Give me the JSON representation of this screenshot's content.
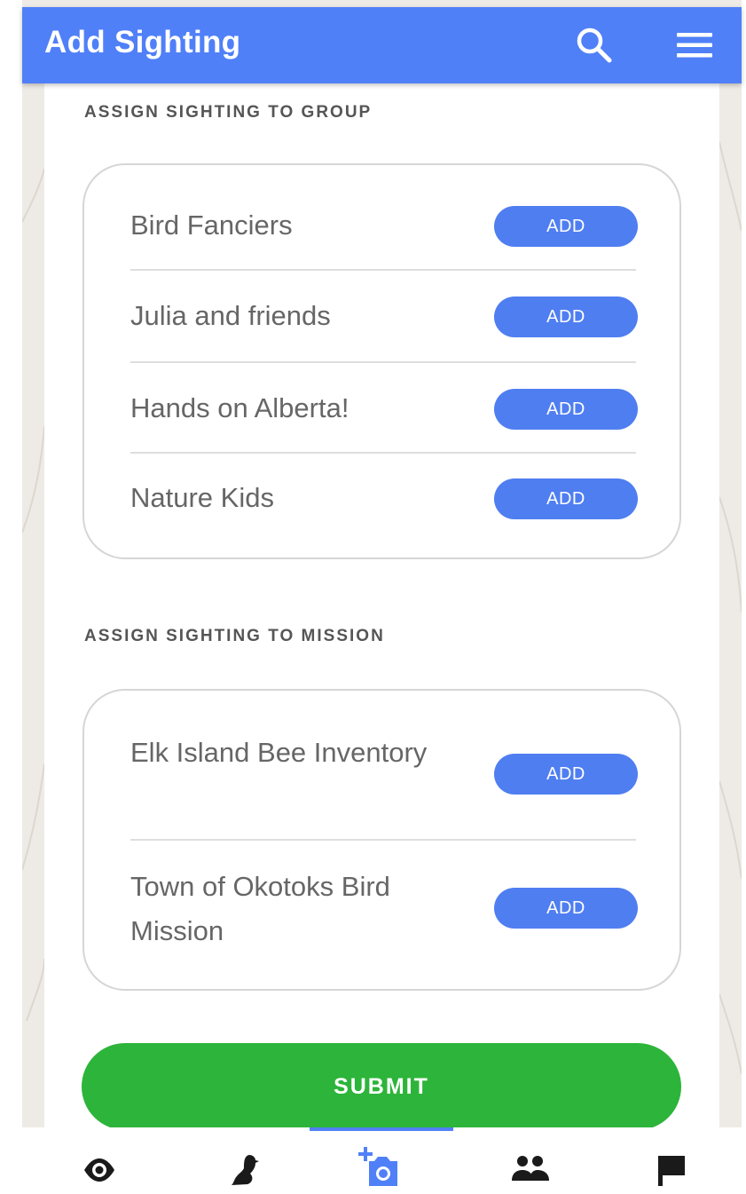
{
  "appbar": {
    "title": "Add Sighting",
    "search_icon": "search-icon",
    "menu_icon": "hamburger-menu-icon",
    "color": "#5080f8"
  },
  "groups": {
    "heading": "ASSIGN SIGHTING TO GROUP",
    "items": [
      {
        "label": "Bird Fanciers",
        "button": "ADD"
      },
      {
        "label": "Julia and friends",
        "button": "ADD"
      },
      {
        "label": "Hands on Alberta!",
        "button": "ADD"
      },
      {
        "label": "Nature Kids",
        "button": "ADD"
      }
    ]
  },
  "missions": {
    "heading": "ASSIGN SIGHTING TO MISSION",
    "items": [
      {
        "label": "Elk Island Bee Inventory",
        "button": "ADD"
      },
      {
        "label": "Town of Okotoks Bird Mission",
        "button": "ADD"
      }
    ]
  },
  "submit": {
    "label": "SUBMIT",
    "color": "#2db43a"
  },
  "bottom_nav": {
    "items": [
      {
        "icon": "eye-icon",
        "active": false
      },
      {
        "icon": "bird-icon",
        "active": false
      },
      {
        "icon": "add-photo-icon",
        "active": true
      },
      {
        "icon": "people-icon",
        "active": false
      },
      {
        "icon": "flag-icon",
        "active": false
      }
    ],
    "active_color": "#5080f8"
  }
}
